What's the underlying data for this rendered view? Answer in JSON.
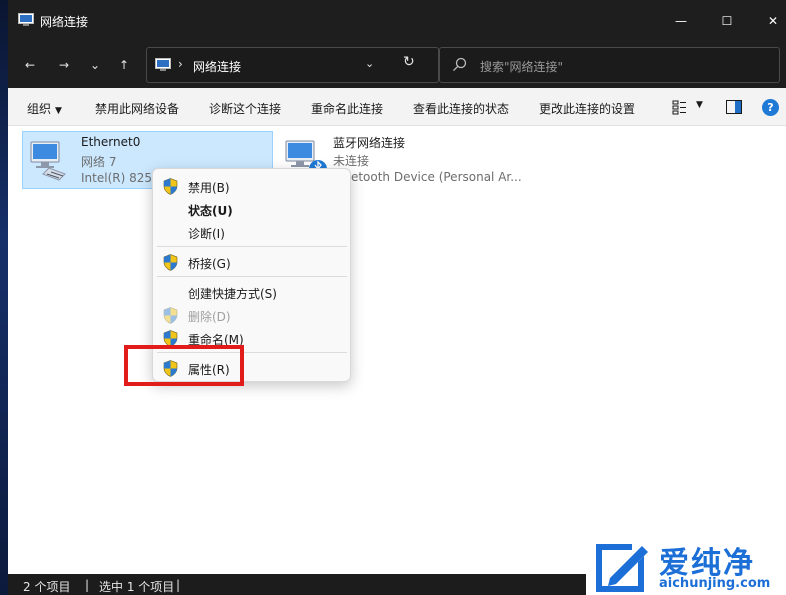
{
  "window": {
    "title": "网络连接",
    "controls": {
      "minimize": "—",
      "maximize": "☐",
      "close": "✕"
    }
  },
  "navigation": {
    "back": "←",
    "forward": "→",
    "history": "⌄",
    "up": "↑",
    "address_separator": "›",
    "address_path": "网络连接",
    "address_dropdown": "⌄",
    "refresh": "↻",
    "search_placeholder": "搜索\"网络连接\""
  },
  "toolbar": {
    "organize": "组织",
    "organize_caret": "▼",
    "disable_device": "禁用此网络设备",
    "diagnose": "诊断这个连接",
    "rename": "重命名此连接",
    "view_status": "查看此连接的状态",
    "change_settings": "更改此连接的设置",
    "view_caret": "▼",
    "help": "?"
  },
  "connections": [
    {
      "name": "Ethernet0",
      "network": "网络 7",
      "device": "Intel(R) 825"
    },
    {
      "name": "蓝牙网络连接",
      "network": "未连接",
      "device": "luetooth Device (Personal Ar..."
    }
  ],
  "context_menu": {
    "items": [
      {
        "label": "禁用(B)",
        "shield": true
      },
      {
        "label": "状态(U)",
        "shield": false,
        "bold": true
      },
      {
        "label": "诊断(I)",
        "shield": false
      },
      {
        "label": "桥接(G)",
        "shield": true
      },
      {
        "label": "创建快捷方式(S)",
        "shield": false
      },
      {
        "label": "删除(D)",
        "shield": true,
        "disabled": true
      },
      {
        "label": "重命名(M)",
        "shield": true
      },
      {
        "label": "属性(R)",
        "shield": true,
        "highlighted": true
      }
    ]
  },
  "statusbar": {
    "item_count": "2 个项目",
    "divider": "|",
    "selected": "选中 1 个项目"
  },
  "watermark": {
    "text": "爱纯净",
    "url": "aichunjing.com"
  },
  "colors": {
    "accent": "#1f7ad6",
    "selection": "#cce8ff",
    "highlight_box": "#e21b1b",
    "titlebar": "#1e1e1e"
  }
}
